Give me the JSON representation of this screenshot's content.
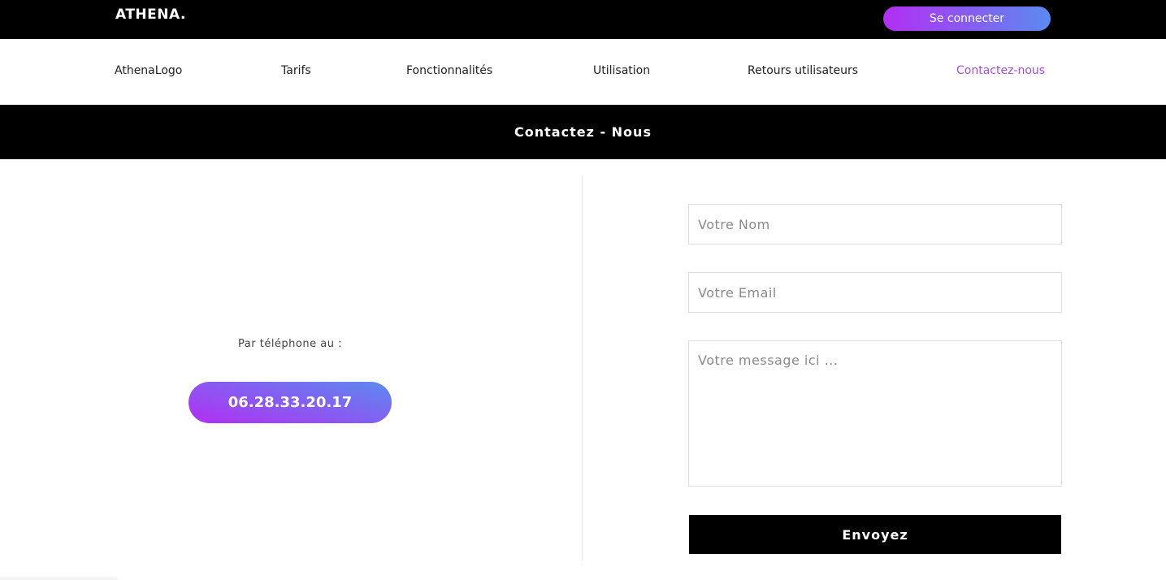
{
  "header": {
    "logo": "ATHENA.",
    "login_label": "Se connecter"
  },
  "nav": {
    "items": [
      {
        "label": "AthenaLogo",
        "active": false
      },
      {
        "label": "Tarifs",
        "active": false
      },
      {
        "label": "Fonctionnalités",
        "active": false
      },
      {
        "label": "Utilisation",
        "active": false
      },
      {
        "label": "Retours utilisateurs",
        "active": false
      },
      {
        "label": "Contactez-nous",
        "active": true
      }
    ]
  },
  "banner": {
    "title": "Contactez - Nous"
  },
  "contact": {
    "phone_label": "Par téléphone au :",
    "phone_number": "06.28.33.20.17"
  },
  "form": {
    "name_placeholder": "Votre Nom",
    "email_placeholder": "Votre Email",
    "message_placeholder": "Votre message ici ...",
    "submit_label": "Envoyez"
  },
  "colors": {
    "gradient_start": "#b22ff2",
    "gradient_end": "#5b8af0",
    "active_nav": "#a54ee8",
    "bar_background": "#000000"
  }
}
